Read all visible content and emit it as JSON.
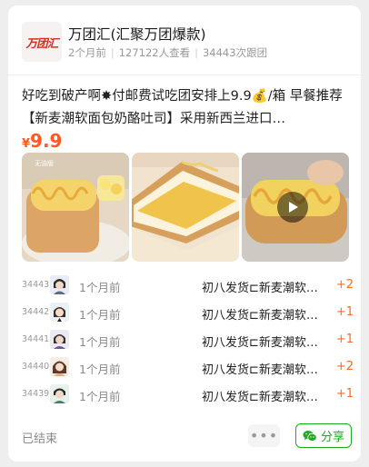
{
  "group": {
    "logo_text": "万团汇",
    "title": "万团汇(汇聚万团爆款)",
    "posted": "2个月前",
    "views": "127122人查看",
    "follows": "34443次跟团"
  },
  "post": {
    "description": "好吃到破产啊✸付邮费试吃团安排上9.9💰/箱 早餐推荐【新麦潮软面包奶酪吐司】采用新西兰进口…",
    "currency": "¥",
    "price": "9.9"
  },
  "photos": [
    {
      "name": "bread-photo-1",
      "caption": "无油版"
    },
    {
      "name": "bread-photo-2"
    },
    {
      "name": "bread-video-thumbnail",
      "has_play": true
    }
  ],
  "orders": [
    {
      "no": "34443",
      "time": "1个月前",
      "item": "初八发货⊏新麦潮软面包奶酪吐司",
      "qty": "+2"
    },
    {
      "no": "34442",
      "time": "1个月前",
      "item": "初八发货⊏新麦潮软面包奶酪吐司",
      "qty": "+1"
    },
    {
      "no": "34441",
      "time": "1个月前",
      "item": "初八发货⊏新麦潮软面包奶酪吐司",
      "qty": "+1"
    },
    {
      "no": "34440",
      "time": "1个月前",
      "item": "初八发货⊏新麦潮软面包奶酪吐司",
      "qty": "+2"
    },
    {
      "no": "34439",
      "time": "1个月前",
      "item": "初八发货⊏新麦潮软面包奶酪吐司",
      "qty": "+1"
    }
  ],
  "footer": {
    "status": "已结束",
    "more_label": "•••",
    "share_label": "分享",
    "share_icon": "wechat-icon"
  },
  "colors": {
    "accent": "#ff5a1f",
    "share_green": "#1aad19",
    "logo_red": "#d2301b"
  }
}
